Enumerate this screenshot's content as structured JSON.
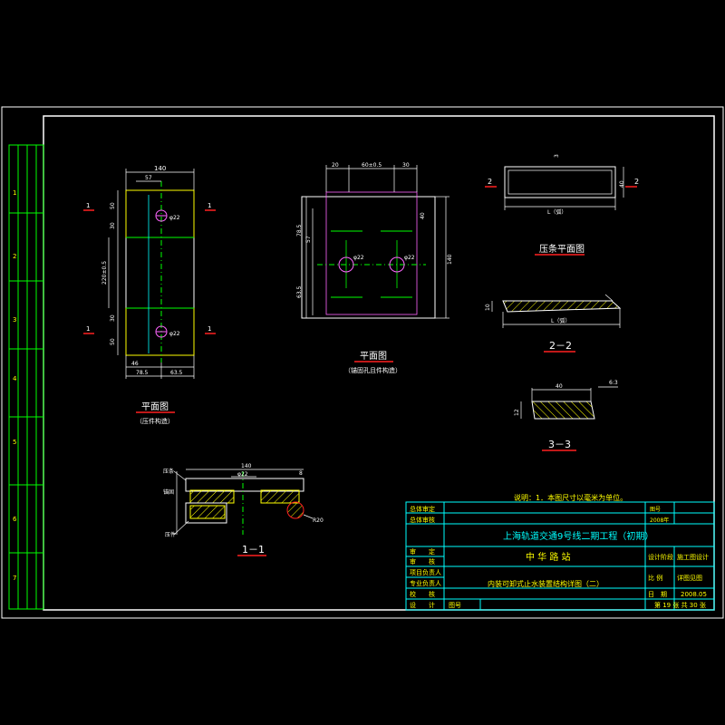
{
  "colors": {
    "background": "#000000",
    "frame": "#ffffff",
    "title_block": "#00ffff",
    "dimension": "#ffffff",
    "section_mark": "#ff2020",
    "centerline": "#00ff00",
    "hatch": "#ffff00",
    "label_text": "#ffff00"
  },
  "note": "说明：1．本图尺寸以毫米为单位。",
  "left_strip": {
    "labels": [
      "1",
      "2",
      "3",
      "4",
      "5",
      "6",
      "7"
    ]
  },
  "views": {
    "plan_press": {
      "title": "平面图",
      "subtitle": "（压件构造）",
      "dims": {
        "top_width": "140",
        "top_inner": "57",
        "left_top": "50",
        "left_mid1": "30",
        "left_span": "220±0.5",
        "left_mid2": "30",
        "left_bottom": "50",
        "bottom_left": "46",
        "bottom_mid": "78.5",
        "bottom_right": "63.5",
        "hole_label": "φ22"
      },
      "section_marks": [
        "1",
        "1",
        "1",
        "1"
      ]
    },
    "plan_anchor": {
      "title": "平面图",
      "subtitle": "（锚固孔且件构造）",
      "dims": {
        "top_left": "20",
        "top_mid": "60±0.5",
        "top_right": "30",
        "left_top": "78.5",
        "left_mid": "57",
        "left_bottom": "63.5",
        "right_top": "40",
        "right_total": "140",
        "hole_label": "φ22"
      }
    },
    "press_strip_plan": {
      "title": "压条平面图",
      "dims": {
        "width": "L（弧）",
        "height": "40",
        "top": "3"
      },
      "section_marks": [
        "2",
        "2"
      ]
    },
    "section_2_2": {
      "title": "2－2",
      "dims": {
        "length": "L（弧）",
        "height": "10"
      }
    },
    "section_3_3": {
      "title": "3－3",
      "dims": {
        "top": "40",
        "left": "12",
        "slope": "6:3"
      }
    },
    "section_1_1": {
      "title": "1－1",
      "dims": {
        "top": "140",
        "inner": "φ22",
        "right": "8",
        "radius": "R20"
      },
      "labels": {
        "left_top": "压条",
        "left_bottom": "压件",
        "left_mid": "锚固"
      }
    }
  },
  "title_block": {
    "review_rows": [
      "总体审定",
      "总体审核"
    ],
    "drawing_no_label": "图号",
    "drawing_no_value": "2008年",
    "project_title": "上海轨道交通9号线二期工程（初期）",
    "left_roles": [
      "审　　定",
      "审　　核",
      "项目负责人",
      "专业负责人",
      "校　　核",
      "设　　计"
    ],
    "station": "中 华 路 站",
    "drawing_title": "内装可卸式止水装置结构详图（二）",
    "design_stage_label": "设计阶段",
    "design_stage_value": "施工图设计",
    "scale_label": "比 例",
    "scale_value": "详图见图",
    "date_label": "日　期",
    "date_value": "2008.05",
    "sheet_label": "图号",
    "sheet_value": "第 19 张  共 30 张"
  }
}
